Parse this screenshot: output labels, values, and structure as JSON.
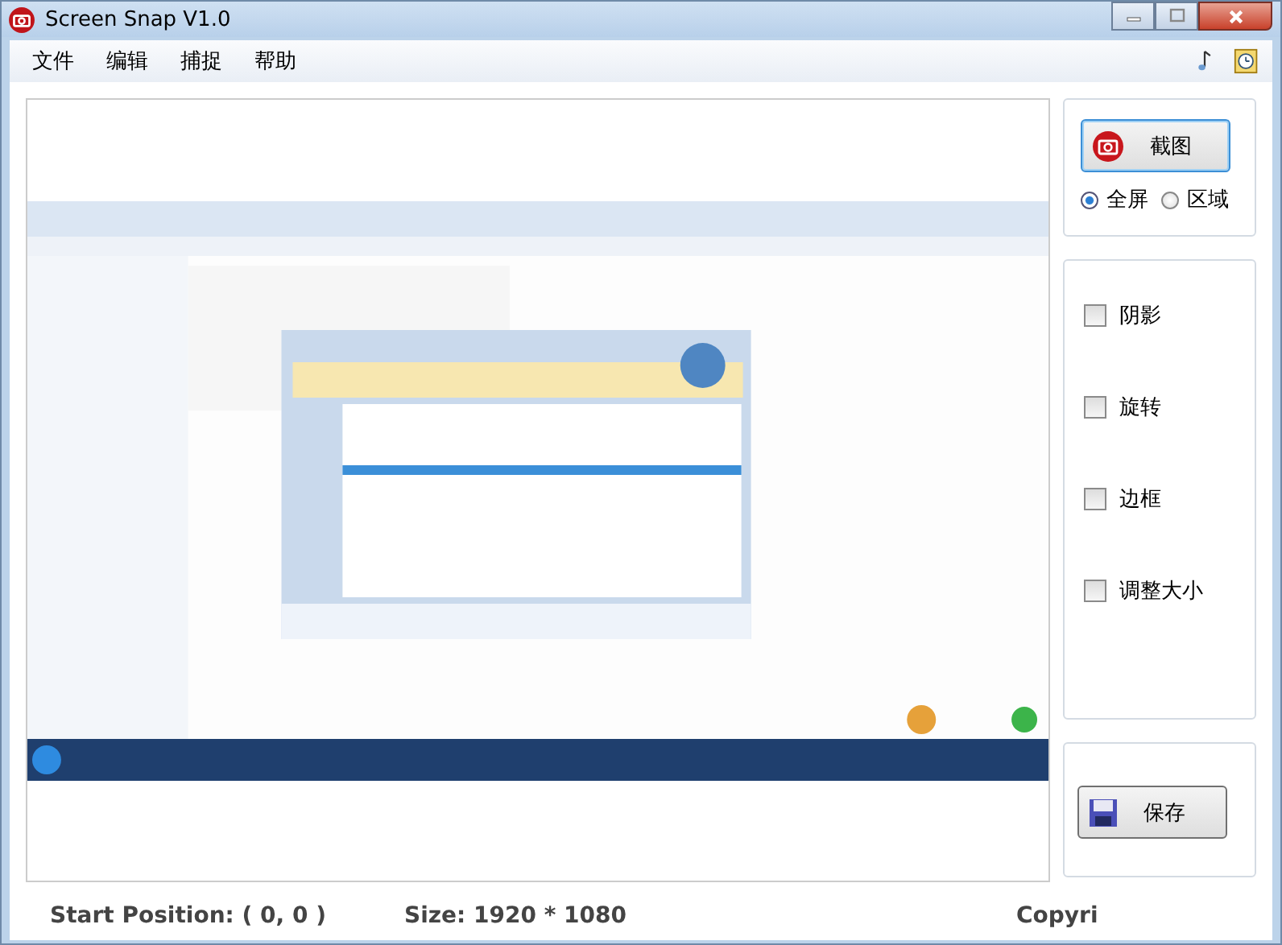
{
  "window": {
    "title": "Screen Snap V1.0"
  },
  "menu": [
    "文件",
    "编辑",
    "捕捉",
    "帮助"
  ],
  "preview": {
    "kind": "picture"
  },
  "capture": {
    "button": "截图",
    "modes": [
      {
        "label": "全屏",
        "selected": true
      },
      {
        "label": "区域",
        "selected": false
      }
    ]
  },
  "options": [
    {
      "label": "阴影",
      "checked": false
    },
    {
      "label": "旋转",
      "checked": false
    },
    {
      "label": "边框",
      "checked": false
    },
    {
      "label": "调整大小",
      "checked": false
    }
  ],
  "save_button": "保存",
  "status_bar": [
    "Start Position:  ( 0, 0 )",
    "Size:  1920 * 1080",
    "Copyri"
  ]
}
